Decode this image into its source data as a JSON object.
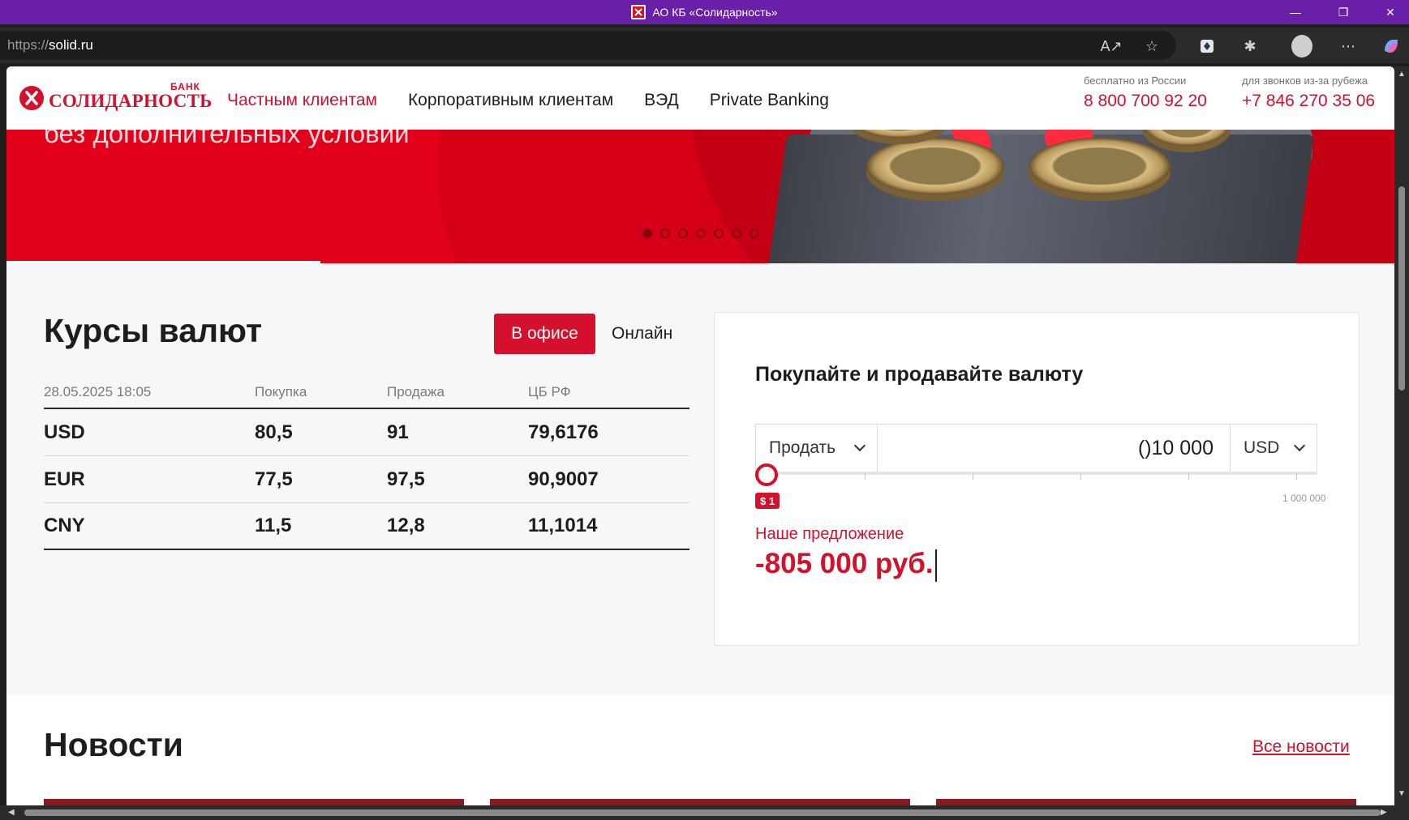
{
  "browser": {
    "window_title": "АО КБ «Солидарность»",
    "url_protocol": "https://",
    "url_host": "solid.ru",
    "icons": [
      "read-aloud-icon",
      "favorite-star-icon",
      "extension-icon",
      "puzzle-icon",
      "profile-icon",
      "more-icon",
      "copilot-icon"
    ]
  },
  "header": {
    "logo_bank": "БАНК",
    "logo_name": "СОЛИДАРНОСТЬ",
    "nav": [
      {
        "label": "Частным клиентам",
        "active": true
      },
      {
        "label": "Корпоративным клиентам",
        "active": false
      },
      {
        "label": "ВЭД",
        "active": false
      },
      {
        "label": "Private Banking",
        "active": false
      }
    ],
    "phones": [
      {
        "caption": "бесплатно из России",
        "number": "8 800 700 92 20"
      },
      {
        "caption": "для звонков из-за рубежа",
        "number": "+7 846 270 35 06"
      }
    ]
  },
  "hero": {
    "slogan": "без дополнительных условий",
    "slide_count": 7,
    "active_slide": 1
  },
  "rates": {
    "title": "Курсы валют",
    "tab_office": "В офисе",
    "tab_online": "Онлайн",
    "columns": [
      "28.05.2025 18:05",
      "Покупка",
      "Продажа",
      "ЦБ РФ"
    ],
    "rows": [
      {
        "code": "USD",
        "buy": "80,5",
        "sell": "91",
        "cbr": "79,6176"
      },
      {
        "code": "EUR",
        "buy": "77,5",
        "sell": "97,5",
        "cbr": "90,9007"
      },
      {
        "code": "CNY",
        "buy": "11,5",
        "sell": "12,8",
        "cbr": "11,1014"
      }
    ]
  },
  "exchange": {
    "title": "Покупайте и продавайте валюту",
    "operation": "Продать",
    "amount": "()10 000",
    "currency": "USD",
    "slider_value_label": "$ 1",
    "slider_max_label": "1 000 000",
    "slider_fraction": 0.0,
    "offer_caption": "Наше предложение",
    "offer_value": "-805 000 руб."
  },
  "news": {
    "title": "Новости",
    "all_link": "Все новости"
  },
  "colors": {
    "brand_red": "#d5102c",
    "titlebar": "#6a1fa8"
  }
}
